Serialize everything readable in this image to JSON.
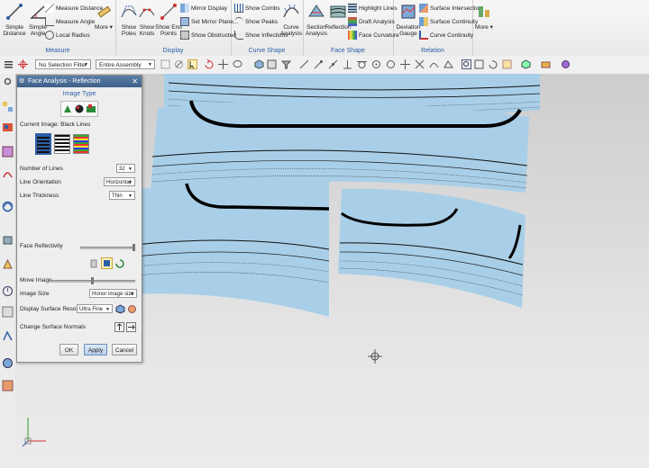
{
  "ribbon": {
    "measure": {
      "group_label": "Measure",
      "simple_distance": "Simple Distance",
      "simple_angle": "Simple Angle",
      "measure_distance": "Measure Distance",
      "measure_angle": "Measure Angle",
      "local_radius": "Local Radius",
      "more": "More"
    },
    "display": {
      "group_label": "Display",
      "show_poles": "Show Poles",
      "show_knots": "Show Knots",
      "show_end_points": "Show End Points",
      "mirror_display": "Mirror Display",
      "set_mirror_plane": "Set Mirror Plane...",
      "show_obstructed": "Show Obstructed"
    },
    "curve_shape": {
      "group_label": "Curve Shape",
      "show_combs": "Show Combs",
      "show_peaks": "Show Peaks",
      "show_inflections": "Show Inflections",
      "curve_analysis": "Curve Analysis"
    },
    "face_shape": {
      "group_label": "Face Shape",
      "section_analysis": "Section Analysis",
      "reflection": "Reflection",
      "highlight_lines": "Highlight Lines",
      "draft_analysis": "Draft Analysis",
      "face_curvature": "Face Curvature"
    },
    "relation": {
      "group_label": "Relation",
      "deviation_gauge": "Deviation Gauge",
      "surface_intersection": "Surface Intersection",
      "surface_continuity": "Surface Continuity",
      "curve_continuity": "Curve Continuity"
    },
    "more": "More"
  },
  "toolbar": {
    "selection_filter": "No Selection Filter",
    "assembly_scope": "Entire Assembly"
  },
  "dialog": {
    "title": "Face Analysis - Reflection",
    "image_type_label": "Image Type",
    "current_image_label": "Current Image: Black Lines",
    "number_of_lines_label": "Number of Lines",
    "number_of_lines_value": "32",
    "line_orientation_label": "Line Orientation",
    "line_orientation_value": "Horizontal",
    "line_thickness_label": "Line Thickness",
    "line_thickness_value": "Thin",
    "face_reflectivity_label": "Face Reflectivity",
    "face_reflectivity_level": 1.0,
    "move_image_label": "Move Image",
    "move_image_level": 0.5,
    "image_size_label": "Image Size",
    "image_size_value": "Honor image size",
    "display_surface_resolution_label": "Display Surface Resolution",
    "display_surface_resolution_value": "Ultra Fine",
    "change_surface_normals_label": "Change Surface Normals",
    "ok": "OK",
    "apply": "Apply",
    "cancel": "Cancel"
  },
  "colors": {
    "surface": "#a9cfe8",
    "dialog_title": "#3d5f8a",
    "accent": "#2d5fa8"
  }
}
